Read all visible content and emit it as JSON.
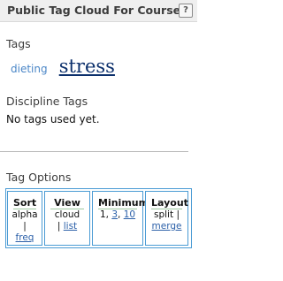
{
  "header": {
    "title": "Public Tag Cloud For Course",
    "help": "?"
  },
  "tags_section": {
    "heading": "Tags",
    "tags": [
      {
        "label": "dieting",
        "size": "small"
      },
      {
        "label": "stress",
        "size": "large"
      }
    ]
  },
  "discipline_section": {
    "heading": "Discipline Tags",
    "empty_message": "No tags used yet."
  },
  "options_section": {
    "heading": "Tag Options",
    "sort": {
      "label": "Sort",
      "current": "alpha",
      "sep": "|",
      "link": "freq"
    },
    "view": {
      "label": "View",
      "current": "cloud",
      "sep": "|",
      "link": "list"
    },
    "minimum": {
      "label": "Minimum",
      "current": "1,",
      "link1": "3",
      "comma": ",",
      "link2": "10"
    },
    "layout": {
      "label": "Layout",
      "current": "split",
      "sep": "|",
      "link": "merge"
    }
  },
  "colors": {
    "link": "#2a5fa8",
    "big_tag": "#0b2f6b",
    "border": "#4a9bd4"
  }
}
